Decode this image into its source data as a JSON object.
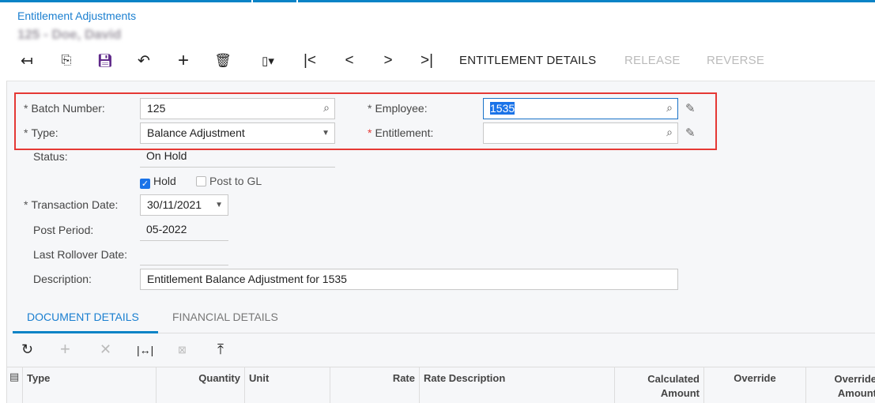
{
  "breadcrumb": "Entitlement Adjustments",
  "title_blurred": "125 - Doe, David",
  "toolbar": {
    "entitlement_details": "ENTITLEMENT DETAILS",
    "release": "RELEASE",
    "reverse": "REVERSE"
  },
  "form": {
    "batch_number_label": "Batch Number:",
    "batch_number": "125",
    "type_label": "Type:",
    "type": "Balance Adjustment",
    "status_label": "Status:",
    "status": "On Hold",
    "hold_label": "Hold",
    "hold": true,
    "post_to_gl_label": "Post to GL",
    "post_to_gl": false,
    "transaction_date_label": "Transaction Date:",
    "transaction_date": "30/11/2021",
    "post_period_label": "Post Period:",
    "post_period": "05-2022",
    "last_rollover_label": "Last Rollover Date:",
    "last_rollover": "",
    "description_label": "Description:",
    "description": "Entitlement  Balance Adjustment for 1535",
    "employee_label": "Employee:",
    "employee": "1535",
    "entitlement_label": "Entitlement:",
    "entitlement": ""
  },
  "tabs": [
    "DOCUMENT DETAILS",
    "FINANCIAL DETAILS"
  ],
  "grid_columns": [
    "Type",
    "Quantity",
    "Unit",
    "Rate",
    "Rate Description",
    "Calculated Amount",
    "Override",
    "Override Amount"
  ],
  "colors": {
    "accent": "#0a83c6",
    "highlight": "#e53935"
  }
}
